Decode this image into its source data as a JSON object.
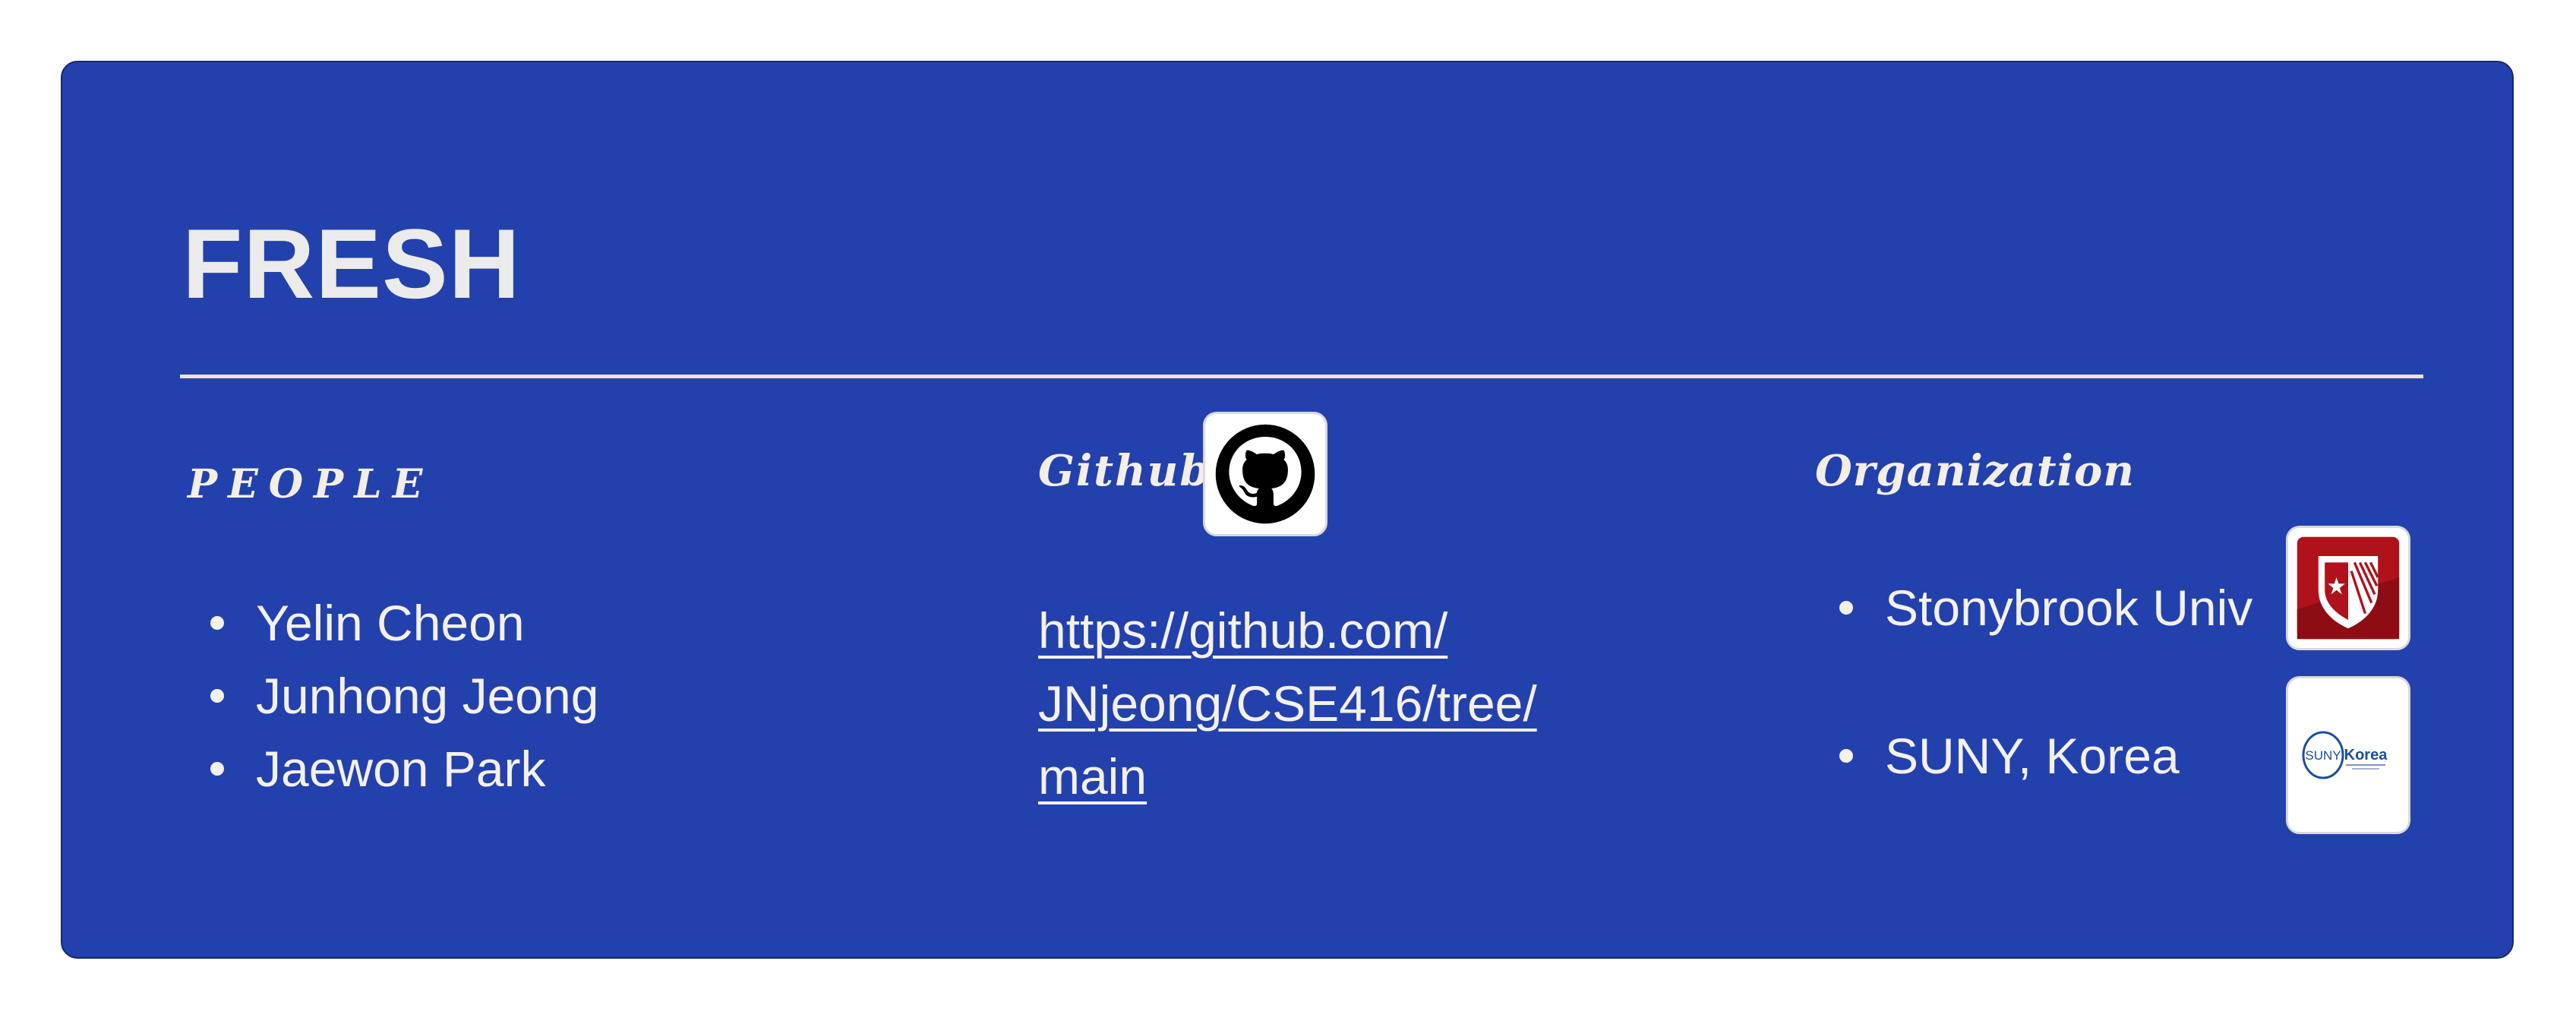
{
  "card": {
    "title": "FRESH",
    "background_color": "#2341ad"
  },
  "people": {
    "label": "PEOPLE",
    "members": [
      "Yelin Cheon",
      "Junhong Jeong",
      "Jaewon Park"
    ]
  },
  "github": {
    "label": "Github",
    "icon": "github-octocat-icon",
    "link_lines": [
      "https://github.com/",
      "JNjeong/CSE416/tree/",
      "main"
    ]
  },
  "organization": {
    "label": "Organization",
    "items": [
      {
        "name": "Stonybrook Univ",
        "logo": "stonybrook-shield-logo"
      },
      {
        "name": "SUNY, Korea",
        "logo": "suny-korea-logo"
      }
    ],
    "suny_logo_text": {
      "left": "SUNY",
      "right": "Korea"
    }
  }
}
